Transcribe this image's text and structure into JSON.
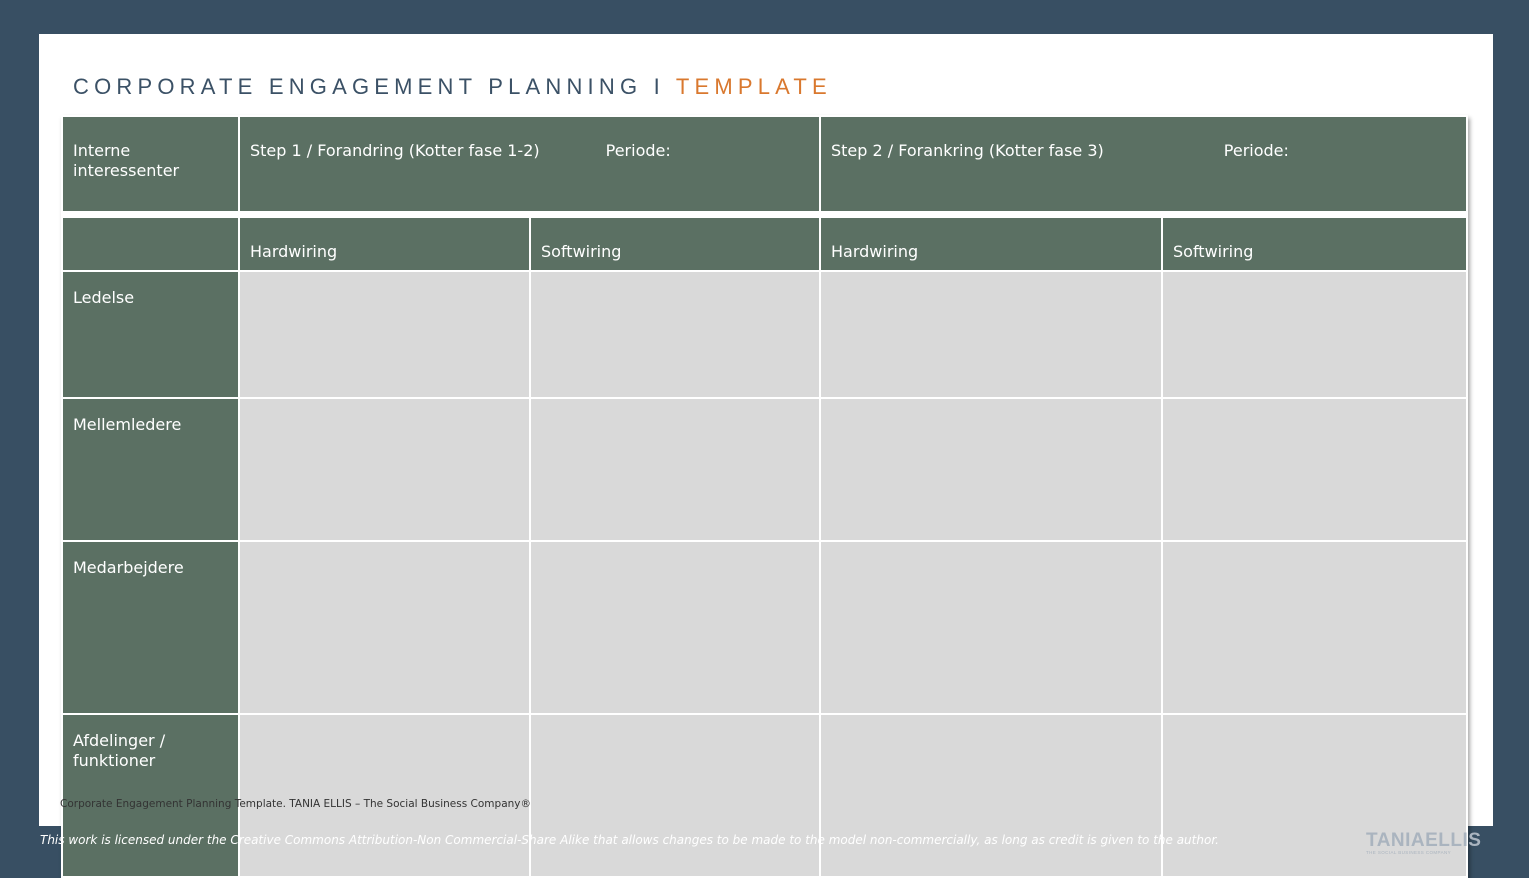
{
  "title": {
    "main": "CORPORATE ENGAGEMENT PLANNING I",
    "accent": "TEMPLATE"
  },
  "colors": {
    "background": "#384f63",
    "header_fill": "#5b7063",
    "cell_fill": "#d9d9d9",
    "accent": "#d9782e",
    "title": "#3b5166"
  },
  "table": {
    "corner_label": "Interne interessenter",
    "step1": {
      "label": "Step 1 / Forandring (Kotter fase 1-2)",
      "period": "Periode:"
    },
    "step2": {
      "label": "Step 2 / Forankring (Kotter fase 3)",
      "period": "Periode:"
    },
    "subheaders": [
      "Hardwiring",
      "Softwiring",
      "Hardwiring",
      "Softwiring"
    ],
    "rows": [
      "Ledelse",
      "Mellemledere",
      "Medarbejdere",
      "Afdelinger / funktioner"
    ]
  },
  "footnote": "Corporate Engagement Planning Template. TANIA ELLIS – The Social Business Company®",
  "license": "This work is licensed under the Creative Commons Attribution-Non Commercial-Share Alike that allows changes to be made to the model non-commercially, as long as credit is given to the author.",
  "logo": {
    "text": "TANIAELLIS",
    "tagline": "THE SOCIAL BUSINESS COMPANY"
  }
}
